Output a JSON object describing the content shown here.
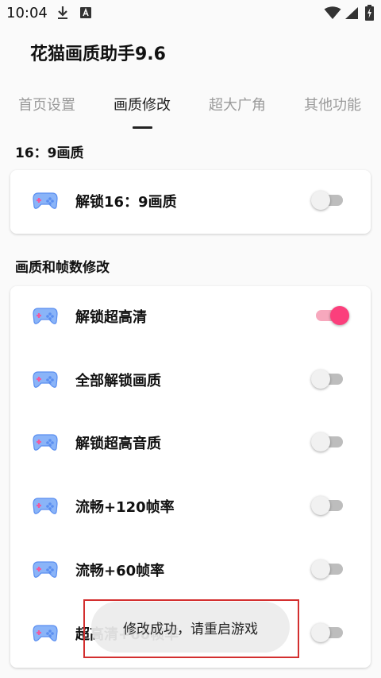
{
  "status_bar": {
    "time": "10:04",
    "icons": [
      "download-icon",
      "text-icon",
      "wifi-icon",
      "signal-icon",
      "battery-charging-icon"
    ]
  },
  "app": {
    "title": "花猫画质助手9.6"
  },
  "tabs": [
    {
      "label": "首页设置",
      "active": false
    },
    {
      "label": "画质修改",
      "active": true
    },
    {
      "label": "超大广角",
      "active": false
    },
    {
      "label": "其他功能",
      "active": false
    }
  ],
  "sections": [
    {
      "title": "16：9画质",
      "items": [
        {
          "label": "解锁16：9画质",
          "on": false
        }
      ]
    },
    {
      "title": "画质和帧数修改",
      "items": [
        {
          "label": "解锁超高清",
          "on": true
        },
        {
          "label": "全部解锁画质",
          "on": false
        },
        {
          "label": "解锁超高音质",
          "on": false
        },
        {
          "label": "流畅+120帧率",
          "on": false
        },
        {
          "label": "流畅+60帧率",
          "on": false
        },
        {
          "label": "超高清+60帧率",
          "on": false
        }
      ]
    }
  ],
  "toast": {
    "message": "修改成功，请重启游戏"
  },
  "colors": {
    "switch_on_thumb": "#fb3f7c",
    "switch_on_track": "#f7a8bd",
    "switch_off_track": "#bdbdbd",
    "highlight_border": "#d32f2f",
    "tab_inactive": "#9a9a9a"
  }
}
